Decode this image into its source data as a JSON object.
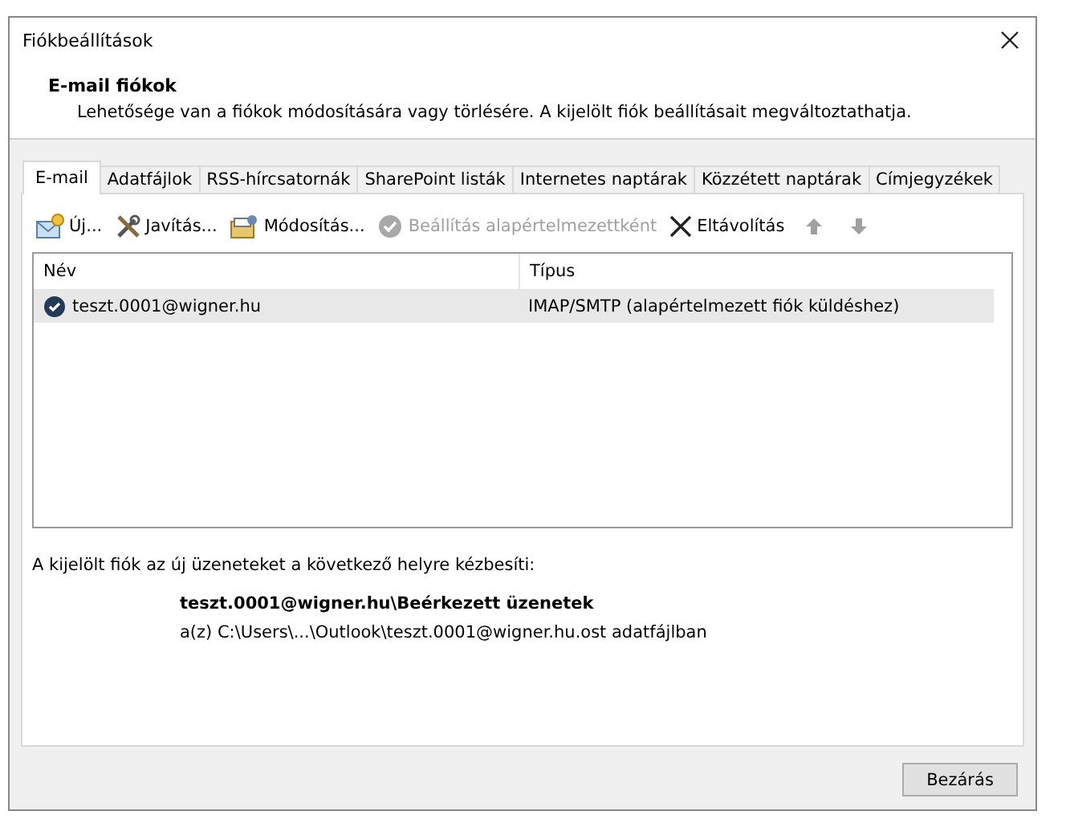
{
  "window": {
    "title": "Fiókbeállítások"
  },
  "header": {
    "title": "E-mail fiókok",
    "description": "Lehetősége van a fiókok módosítására vagy törlésére. A kijelölt fiók beállításait megváltoztathatja."
  },
  "tabs": [
    {
      "label": "E-mail",
      "selected": true
    },
    {
      "label": "Adatfájlok",
      "selected": false
    },
    {
      "label": "RSS-hírcsatornák",
      "selected": false
    },
    {
      "label": "SharePoint listák",
      "selected": false
    },
    {
      "label": "Internetes naptárak",
      "selected": false
    },
    {
      "label": "Közzétett naptárak",
      "selected": false
    },
    {
      "label": "Címjegyzékek",
      "selected": false
    }
  ],
  "toolbar": [
    {
      "kind": "new",
      "label": "Új...",
      "disabled": false
    },
    {
      "kind": "repair",
      "label": "Javítás...",
      "disabled": false
    },
    {
      "kind": "change",
      "label": "Módosítás...",
      "disabled": false
    },
    {
      "kind": "default",
      "label": "Beállítás alapértelmezettként",
      "disabled": true
    },
    {
      "kind": "remove",
      "label": "Eltávolítás",
      "disabled": false
    },
    {
      "kind": "up",
      "disabled": true
    },
    {
      "kind": "down",
      "disabled": true
    }
  ],
  "table": {
    "columns": [
      "Név",
      "Típus"
    ],
    "rows": [
      {
        "name": "teszt.0001@wigner.hu",
        "type": "IMAP/SMTP (alapértelmezett fiók küldéshez)",
        "selected": true,
        "default": true
      }
    ]
  },
  "delivery": {
    "intro": "A kijelölt fiók az új üzeneteket a következő helyre kézbesíti:",
    "folder": "teszt.0001@wigner.hu\\Beérkezett üzenetek",
    "file": "a(z) C:\\Users\\...\\Outlook\\teszt.0001@wigner.hu.ost adatfájlban"
  },
  "buttons": [
    "Bezárás"
  ]
}
